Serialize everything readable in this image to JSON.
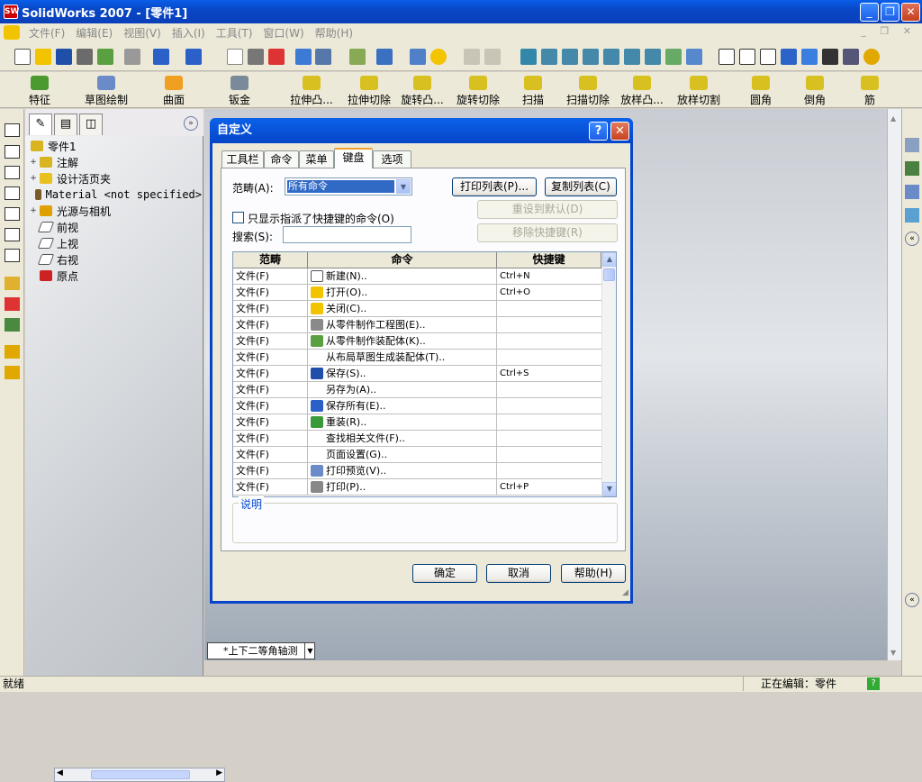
{
  "window": {
    "title": "SolidWorks 2007 - [零件1]",
    "app_icon": "SW"
  },
  "menu": [
    "文件(F)",
    "编辑(E)",
    "视图(V)",
    "插入(I)",
    "工具(T)",
    "窗口(W)",
    "帮助(H)"
  ],
  "features": {
    "items": [
      "特征",
      "草图绘制",
      "曲面",
      "钣金",
      "拉伸凸...",
      "拉伸切除",
      "旋转凸...",
      "旋转切除",
      "扫描",
      "扫描切除",
      "放样凸...",
      "放样切割",
      "圆角",
      "倒角",
      "筋"
    ]
  },
  "tree": {
    "root": "零件1",
    "items": [
      {
        "label": "注解",
        "expand": "+",
        "icon": "annotation-icon"
      },
      {
        "label": "设计活页夹",
        "expand": "+",
        "icon": "design-binder-icon"
      },
      {
        "label": "Material <not specified>",
        "expand": "",
        "icon": "material-icon"
      },
      {
        "label": "光源与相机",
        "expand": "+",
        "icon": "lights-camera-icon"
      },
      {
        "label": "前视",
        "expand": "",
        "icon": "plane-icon"
      },
      {
        "label": "上视",
        "expand": "",
        "icon": "plane-icon"
      },
      {
        "label": "右视",
        "expand": "",
        "icon": "plane-icon"
      },
      {
        "label": "原点",
        "expand": "",
        "icon": "origin-icon"
      }
    ]
  },
  "dialog": {
    "title": "自定义",
    "tabs": [
      "工具栏",
      "命令",
      "菜单",
      "键盘",
      "选项"
    ],
    "active_tab": "键盘",
    "scope_label": "范畴(A):",
    "scope_value": "所有命令",
    "print_list": "打印列表(P)...",
    "copy_list": "复制列表(C)",
    "only_assigned_label": "只显示指派了快捷键的命令(O)",
    "reset_default": "重设到默认(D)",
    "remove_shortcut": "移除快捷键(R)",
    "search_label": "搜索(S):",
    "search_value": "",
    "columns": [
      "范畴",
      "命令",
      "快捷键"
    ],
    "rows": [
      {
        "category": "文件(F)",
        "command": "新建(N)..",
        "shortcut": "Ctrl+N",
        "icon": "new-file-icon"
      },
      {
        "category": "文件(F)",
        "command": "打开(O)..",
        "shortcut": "Ctrl+O",
        "icon": "open-folder-icon"
      },
      {
        "category": "文件(F)",
        "command": "关闭(C)..",
        "shortcut": "",
        "icon": "close-file-icon"
      },
      {
        "category": "文件(F)",
        "command": "从零件制作工程图(E)..",
        "shortcut": "",
        "icon": "make-drawing-icon"
      },
      {
        "category": "文件(F)",
        "command": "从零件制作装配体(K)..",
        "shortcut": "",
        "icon": "make-assembly-icon"
      },
      {
        "category": "文件(F)",
        "command": "从布局草图生成装配体(T)..",
        "shortcut": "",
        "icon": ""
      },
      {
        "category": "文件(F)",
        "command": "保存(S)..",
        "shortcut": "Ctrl+S",
        "icon": "save-icon"
      },
      {
        "category": "文件(F)",
        "command": "另存为(A)..",
        "shortcut": "",
        "icon": ""
      },
      {
        "category": "文件(F)",
        "command": "保存所有(E)..",
        "shortcut": "",
        "icon": "save-all-icon"
      },
      {
        "category": "文件(F)",
        "command": "重装(R)..",
        "shortcut": "",
        "icon": "reload-icon"
      },
      {
        "category": "文件(F)",
        "command": "查找相关文件(F)..",
        "shortcut": "",
        "icon": ""
      },
      {
        "category": "文件(F)",
        "command": "页面设置(G)..",
        "shortcut": "",
        "icon": ""
      },
      {
        "category": "文件(F)",
        "command": "打印预览(V)..",
        "shortcut": "",
        "icon": "print-preview-icon"
      },
      {
        "category": "文件(F)",
        "command": "打印(P)..",
        "shortcut": "Ctrl+P",
        "icon": "print-icon"
      }
    ],
    "description_label": "说明",
    "ok": "确定",
    "cancel": "取消",
    "help": "帮助(H)"
  },
  "view_tab": "*上下二等角轴测",
  "status": {
    "left": "就绪",
    "right": "正在编辑：零件",
    "help": "?"
  },
  "colors": {
    "titlebar": "#0a54e0",
    "menu_bg": "#ece9d8",
    "selection": "#316ac5",
    "close": "#d04a2a"
  }
}
